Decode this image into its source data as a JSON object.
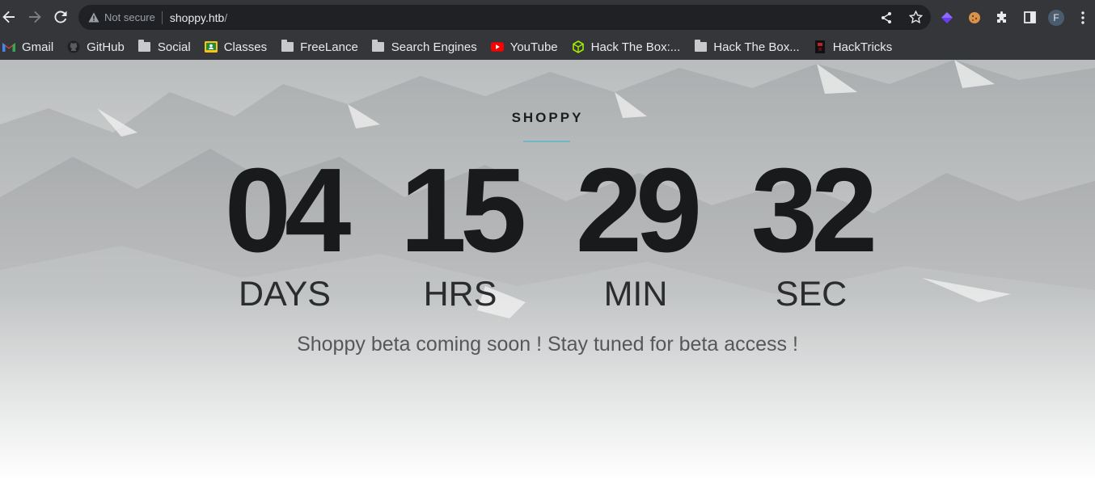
{
  "browser": {
    "security_label": "Not secure",
    "url_host": "shoppy.htb",
    "url_path": "/",
    "profile_initial": "F"
  },
  "bookmarks": [
    {
      "label": "Gmail",
      "icon": "gmail-icon"
    },
    {
      "label": "GitHub",
      "icon": "github-icon"
    },
    {
      "label": "Social",
      "icon": "folder-icon"
    },
    {
      "label": "Classes",
      "icon": "classroom-icon"
    },
    {
      "label": "FreeLance",
      "icon": "folder-icon"
    },
    {
      "label": "Search Engines",
      "icon": "folder-icon"
    },
    {
      "label": "YouTube",
      "icon": "youtube-icon"
    },
    {
      "label": "Hack The Box:...",
      "icon": "htb-icon"
    },
    {
      "label": "Hack The Box...",
      "icon": "folder-icon"
    },
    {
      "label": "HackTricks",
      "icon": "hacktricks-icon"
    }
  ],
  "page": {
    "brand": "SHOPPY",
    "countdown": [
      {
        "value": "04",
        "label": "DAYS"
      },
      {
        "value": "15",
        "label": "HRS"
      },
      {
        "value": "29",
        "label": "MIN"
      },
      {
        "value": "32",
        "label": "SEC"
      }
    ],
    "tagline": "Shoppy beta coming soon ! Stay tuned for beta access !"
  },
  "colors": {
    "toolbar": "#35363a",
    "omnibox": "#202124",
    "accent_line": "#6fb8c2",
    "digits": "#181a1b"
  }
}
